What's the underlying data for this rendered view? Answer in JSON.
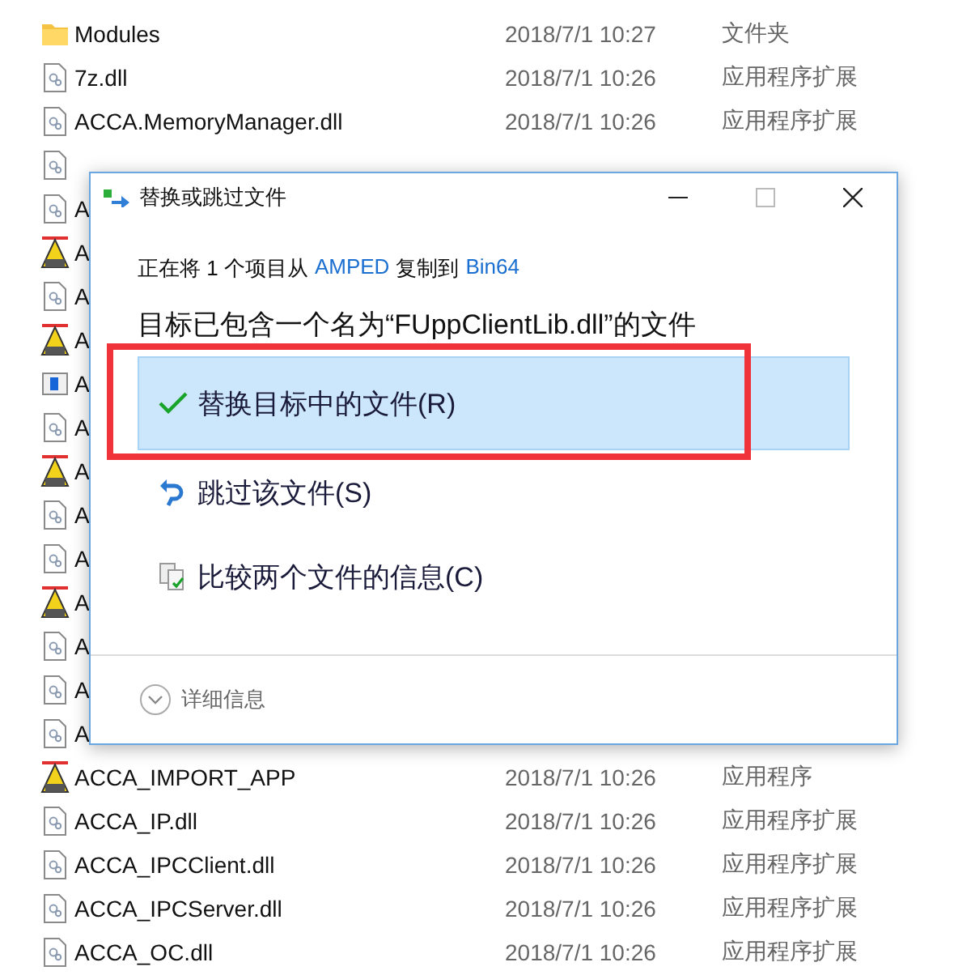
{
  "files": [
    {
      "kind": "folder",
      "name": "Modules",
      "modified": "2018/7/1 10:27",
      "type": "文件夹"
    },
    {
      "kind": "dll",
      "name": "7z.dll",
      "modified": "2018/7/1 10:26",
      "type": "应用程序扩展"
    },
    {
      "kind": "dll",
      "name": "ACCA.MemoryManager.dll",
      "modified": "2018/7/1 10:26",
      "type": "应用程序扩展"
    },
    {
      "kind": "dll"
    },
    {
      "kind": "dll",
      "name": "A"
    },
    {
      "kind": "app",
      "name": "A"
    },
    {
      "kind": "dll",
      "name": "A"
    },
    {
      "kind": "app",
      "name": "A"
    },
    {
      "kind": "window",
      "name": "A"
    },
    {
      "kind": "dll",
      "name": "A"
    },
    {
      "kind": "app",
      "name": "A"
    },
    {
      "kind": "dll",
      "name": "A"
    },
    {
      "kind": "dll",
      "name": "A"
    },
    {
      "kind": "app",
      "name": "A"
    },
    {
      "kind": "dll",
      "name": "A"
    },
    {
      "kind": "dll",
      "name": "A"
    },
    {
      "kind": "dll",
      "name": "A"
    },
    {
      "kind": "app",
      "name": "ACCA_IMPORT_APP",
      "modified": "2018/7/1 10:26",
      "type": "应用程序"
    },
    {
      "kind": "dll",
      "name": "ACCA_IP.dll",
      "modified": "2018/7/1 10:26",
      "type": "应用程序扩展"
    },
    {
      "kind": "dll",
      "name": "ACCA_IPCClient.dll",
      "modified": "2018/7/1 10:26",
      "type": "应用程序扩展"
    },
    {
      "kind": "dll",
      "name": "ACCA_IPCServer.dll",
      "modified": "2018/7/1 10:26",
      "type": "应用程序扩展"
    },
    {
      "kind": "dll",
      "name": "ACCA_OC.dll",
      "modified": "2018/7/1 10:26",
      "type": "应用程序扩展"
    }
  ],
  "dialog": {
    "title": "替换或跳过文件",
    "copy_line": {
      "prefix": "正在将 1 个项目从",
      "source": "AMPED",
      "middle": "复制到",
      "destination": "Bin64"
    },
    "heading": "目标已包含一个名为“FUppClientLib.dll”的文件",
    "options": [
      {
        "kind": "replace",
        "label": "替换目标中的文件(R)",
        "selected": true
      },
      {
        "kind": "skip",
        "label": "跳过该文件(S)",
        "selected": false
      },
      {
        "kind": "compare",
        "label": "比较两个文件的信息(C)",
        "selected": false
      }
    ],
    "details": "详细信息"
  }
}
